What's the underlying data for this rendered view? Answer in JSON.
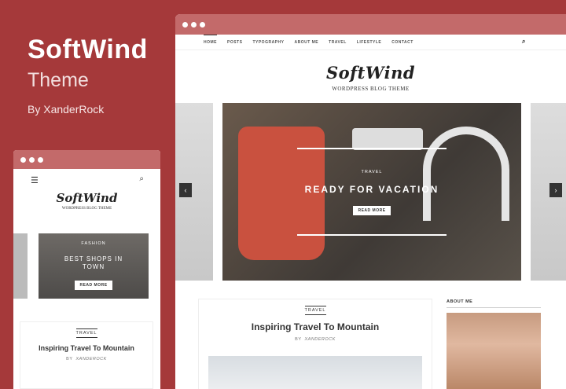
{
  "promo": {
    "title": "SoftWind",
    "subtitle": "Theme",
    "author": "By XanderRock"
  },
  "desktop": {
    "nav": [
      "HOME",
      "POSTS",
      "TYPOGRAPHY",
      "ABOUT ME",
      "TRAVEL",
      "LIFESTYLE",
      "CONTACT"
    ],
    "logo": "SoftWind",
    "tagline": "WORDPRESS BLOG THEME",
    "hero": {
      "category": "TRAVEL",
      "title": "READY FOR VACATION",
      "button": "READ MORE"
    },
    "post": {
      "category": "TRAVEL",
      "title": "Inspiring Travel To Mountain",
      "by": "BY",
      "author": "XANDEROCK"
    },
    "about": "ABOUT ME"
  },
  "mobile": {
    "logo": "SoftWind",
    "tagline": "WORDPRESS BLOG THEME",
    "slide": {
      "category": "FASHION",
      "title": "BEST SHOPS IN TOWN",
      "button": "READ MORE"
    },
    "post": {
      "category": "TRAVEL",
      "title": "Inspiring Travel To Mountain",
      "by": "BY",
      "author": "XANDEROCK"
    }
  }
}
